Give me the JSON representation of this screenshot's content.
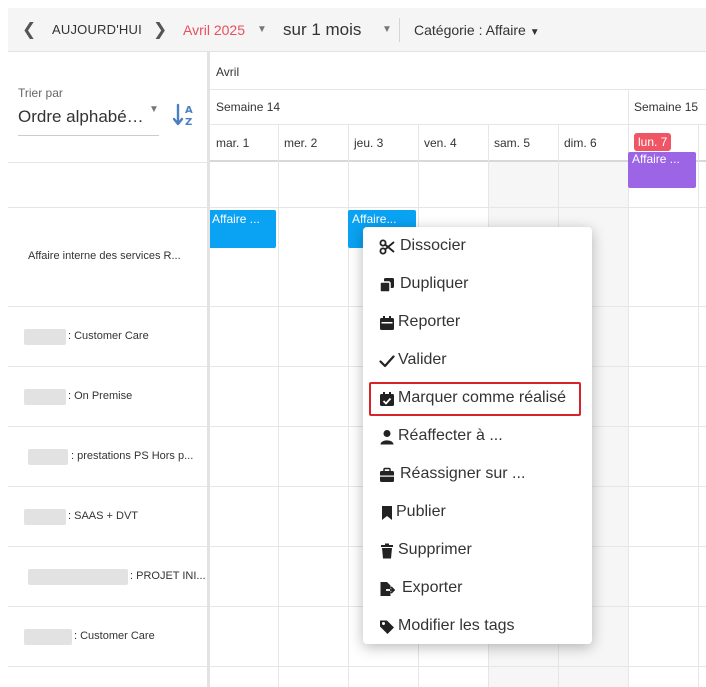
{
  "toolbar": {
    "prev_icon": "chevron-left-icon",
    "today_label": "AUJOURD'HUI",
    "next_icon": "chevron-right-icon",
    "month_label": "Avril 2025",
    "period_label": "sur 1 mois",
    "category_label": "Catégorie : Affaire",
    "accent_color": "#e8505b"
  },
  "sidebar": {
    "sort_label": "Trier par",
    "sort_value": "Ordre alphabé…",
    "sort_icon": "sort-alpha-desc-icon",
    "rows": [
      {
        "label": "Affaire interne des services R..."
      },
      {
        "label": ": Customer Care"
      },
      {
        "label": ": On Premise"
      },
      {
        "label": ": prestations PS Hors p..."
      },
      {
        "label": ": SAAS + DVT"
      },
      {
        "label": ": PROJET INI..."
      },
      {
        "label": ": Customer Care"
      }
    ]
  },
  "calendar": {
    "month": "Avril",
    "week14": "Semaine 14",
    "week15": "Semaine 15",
    "days": [
      "mar. 1",
      "mer. 2",
      "jeu. 3",
      "ven. 4",
      "sam. 5",
      "dim. 6",
      "lun. 7"
    ],
    "events": [
      {
        "label": "Affaire ...",
        "color": "#0aa2f3"
      },
      {
        "label": "Affaire...",
        "color": "#0aa2f3"
      },
      {
        "label": "Affaire ...",
        "color": "#9b65e6"
      }
    ]
  },
  "context_menu": {
    "items": [
      {
        "label": "Dissocier",
        "icon": "scissors-icon"
      },
      {
        "label": "Dupliquer",
        "icon": "copy-icon"
      },
      {
        "label": "Reporter",
        "icon": "calendar-icon"
      },
      {
        "label": "Valider",
        "icon": "check-icon"
      },
      {
        "label": "Marquer comme réalisé",
        "icon": "calendar-check-icon"
      },
      {
        "label": "Réaffecter à ...",
        "icon": "user-icon"
      },
      {
        "label": "Réassigner sur ...",
        "icon": "briefcase-icon"
      },
      {
        "label": "Publier",
        "icon": "bookmark-icon"
      },
      {
        "label": "Supprimer",
        "icon": "trash-icon"
      },
      {
        "label": "Exporter",
        "icon": "file-export-icon"
      },
      {
        "label": "Modifier les tags",
        "icon": "tag-icon"
      }
    ],
    "highlight_color": "#d8232a"
  }
}
